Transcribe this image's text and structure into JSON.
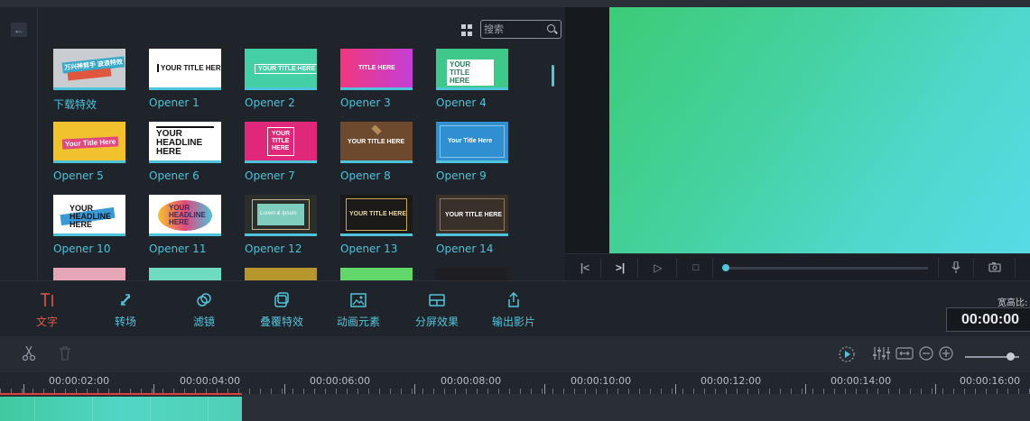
{
  "library": {
    "search_placeholder": "搜索",
    "tiles": [
      {
        "label": "下载特效",
        "thumb_text": "万兴神剪手 波浪特效",
        "bg": "#c9cdd2"
      },
      {
        "label": "Opener 1",
        "thumb_text": "YOUR TITLE HERE",
        "bg": "#ffffff"
      },
      {
        "label": "Opener 2",
        "thumb_text": "YOUR TITLE HERE",
        "bg": "#45cfa6"
      },
      {
        "label": "Opener 3",
        "thumb_text": "TITLE HERE",
        "bg": "#e83fb8"
      },
      {
        "label": "Opener 4",
        "thumb_text": "YOUR TITLE HERE",
        "bg": "#3ec98a"
      },
      {
        "label": "Opener 5",
        "thumb_text": "Your Title Here",
        "bg": "#f2c22e"
      },
      {
        "label": "Opener 6",
        "thumb_text": "YOUR HEADLINE HERE",
        "bg": "#ffffff"
      },
      {
        "label": "Opener 7",
        "thumb_text": "YOUR TITLE HERE",
        "bg": "#e0287a"
      },
      {
        "label": "Opener 8",
        "thumb_text": "YOUR TITLE HERE",
        "bg": "#6d4a2e"
      },
      {
        "label": "Opener 9",
        "thumb_text": "Your Title Here",
        "bg": "#2f8fd1"
      },
      {
        "label": "Opener 10",
        "thumb_text": "YOUR HEADLINE HERE",
        "bg": "#ffffff"
      },
      {
        "label": "Opener 11",
        "thumb_text": "YOUR HEADLINE HERE",
        "bg": "#ffffff"
      },
      {
        "label": "Opener 12",
        "thumb_text": "Lorem & Ipsum",
        "bg": "#2b2f2c"
      },
      {
        "label": "Opener 13",
        "thumb_text": "YOUR TITLE HERE",
        "bg": "#1c1a18"
      },
      {
        "label": "Opener 14",
        "thumb_text": "YOUR TITLE HERE",
        "bg": "#3a302a"
      }
    ],
    "partial_row_colors": [
      "#e6a6b8",
      "#6fdcc0",
      "#b8962e",
      "#62d86a",
      "#1e1e22"
    ]
  },
  "toolbar": {
    "items": [
      {
        "label": "文字",
        "icon": "text-icon",
        "active": true
      },
      {
        "label": "转场",
        "icon": "transition-icon",
        "active": false
      },
      {
        "label": "滤镜",
        "icon": "filter-icon",
        "active": false
      },
      {
        "label": "叠覆特效",
        "icon": "overlay-icon",
        "active": false
      },
      {
        "label": "动画元素",
        "icon": "image-icon",
        "active": false
      },
      {
        "label": "分屏效果",
        "icon": "split-screen-icon",
        "active": false
      },
      {
        "label": "输出影片",
        "icon": "export-icon",
        "active": false
      }
    ],
    "ratio_label": "宽高比:",
    "timecode": "00:00:00"
  },
  "timeline": {
    "ruler_labels": [
      "00:00:02:00",
      "00:00:04:00",
      "00:00:06:00",
      "00:00:08:00",
      "00:00:10:00",
      "00:00:12:00",
      "00:00:14:00",
      "00:00:16:00"
    ]
  },
  "colors": {
    "accent": "#4fc3d9",
    "active": "#e05a4a",
    "playhead": "#d8443a"
  }
}
